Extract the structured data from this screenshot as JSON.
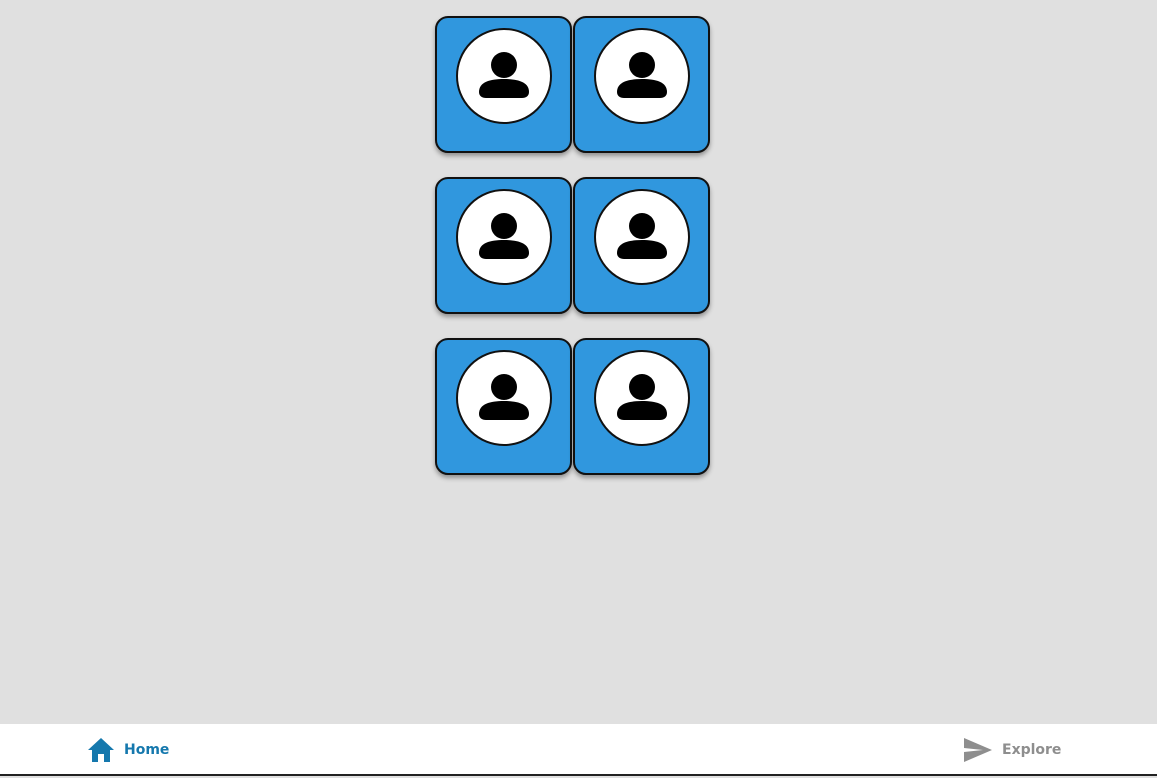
{
  "cards": [
    {
      "icon": "person-avatar-icon"
    },
    {
      "icon": "person-avatar-icon"
    },
    {
      "icon": "person-avatar-icon"
    },
    {
      "icon": "person-avatar-icon"
    },
    {
      "icon": "person-avatar-icon"
    },
    {
      "icon": "person-avatar-icon"
    }
  ],
  "bottom_nav": {
    "home": {
      "label": "Home",
      "icon": "home-icon",
      "active": true
    },
    "explore": {
      "label": "Explore",
      "icon": "send-icon",
      "active": false
    }
  },
  "colors": {
    "background": "#e0e0e0",
    "card": "#3097de",
    "active_nav": "#1578ad",
    "inactive_nav": "#8e8e8e"
  }
}
